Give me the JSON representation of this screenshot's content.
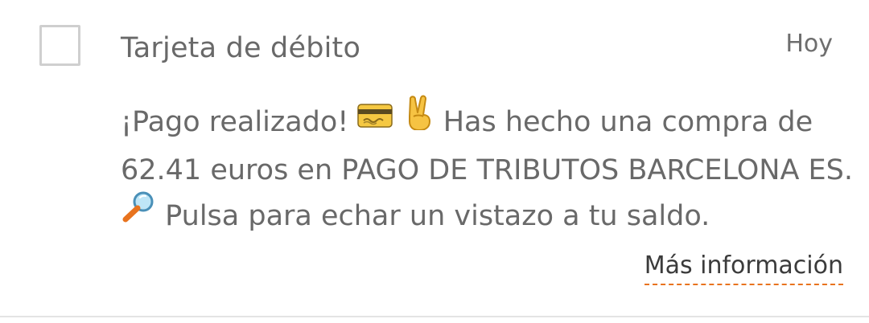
{
  "notification": {
    "title": "Tarjeta de débito",
    "time": "Hoy",
    "body": {
      "line1_text_a": "¡Pago realizado! ",
      "line1_icon_card": "credit-card-icon",
      "line1_icon_victory": "victory-hand-icon",
      "line1_text_b": " Has hecho una compra de",
      "line2_text": "62.41 euros en PAGO DE TRIBUTOS BARCELONA ES.",
      "line3_icon": "magnifying-glass-icon",
      "line3_text": " Pulsa para echar un vistazo a tu saldo."
    },
    "more_link": "Más información"
  },
  "colors": {
    "text": "#696969",
    "link_text": "#3b3b3b",
    "link_underline": "#e8731e",
    "checkbox_border": "#cfcfcf",
    "divider": "#e4e4e4"
  }
}
